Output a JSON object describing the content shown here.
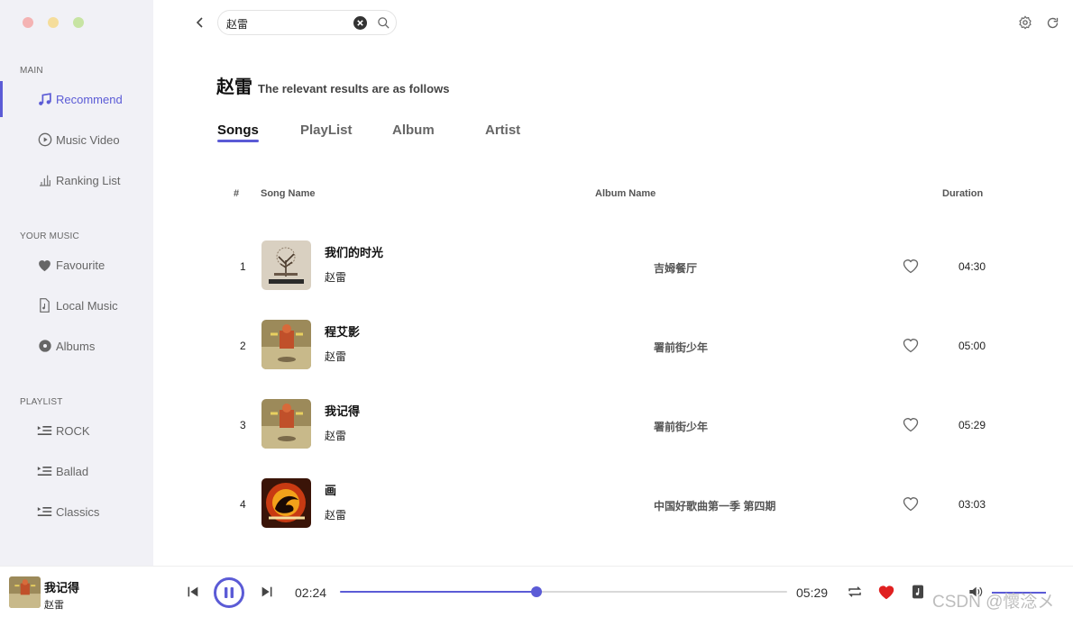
{
  "sidebar": {
    "sections": [
      {
        "label": "MAIN",
        "items": [
          {
            "label": "Recommend",
            "icon": "music-note-icon",
            "active": true
          },
          {
            "label": "Music Video",
            "icon": "play-circle-icon"
          },
          {
            "label": "Ranking List",
            "icon": "bar-chart-icon"
          }
        ]
      },
      {
        "label": "YOUR MUSIC",
        "items": [
          {
            "label": "Favourite",
            "icon": "heart-icon"
          },
          {
            "label": "Local Music",
            "icon": "file-music-icon"
          },
          {
            "label": "Albums",
            "icon": "disc-icon"
          }
        ]
      },
      {
        "label": "PLAYLIST",
        "items": [
          {
            "label": "ROCK",
            "icon": "playlist-icon"
          },
          {
            "label": "Ballad",
            "icon": "playlist-icon"
          },
          {
            "label": "Classics",
            "icon": "playlist-icon"
          }
        ]
      }
    ]
  },
  "search": {
    "value": "赵雷",
    "placeholder": ""
  },
  "result": {
    "query": "赵雷",
    "subtitle": "The relevant results are as follows"
  },
  "tabs": [
    {
      "label": "Songs",
      "active": true
    },
    {
      "label": "PlayList"
    },
    {
      "label": "Album"
    },
    {
      "label": "Artist"
    }
  ],
  "table": {
    "headers": {
      "index": "#",
      "song": "Song Name",
      "album": "Album Name",
      "duration": "Duration"
    },
    "rows": [
      {
        "index": "1",
        "name": "我们的时光",
        "artist": "赵雷",
        "album": "吉姆餐厅",
        "duration": "04:30",
        "cover": "restaurant"
      },
      {
        "index": "2",
        "name": "程艾影",
        "artist": "赵雷",
        "album": "署前街少年",
        "duration": "05:00",
        "cover": "street"
      },
      {
        "index": "3",
        "name": "我记得",
        "artist": "赵雷",
        "album": "署前街少年",
        "duration": "05:29",
        "cover": "street"
      },
      {
        "index": "4",
        "name": "画",
        "artist": "赵雷",
        "album": "中国好歌曲第一季 第四期",
        "duration": "03:03",
        "cover": "sing"
      }
    ]
  },
  "player": {
    "title": "我记得",
    "artist": "赵雷",
    "current_time": "02:24",
    "total_time": "05:29",
    "progress": 0.44,
    "liked": true
  },
  "watermark": "CSDN @懷淰メ",
  "colors": {
    "accent": "#5b5bd6",
    "like": "#e02020",
    "sidebar_bg": "#f1f1f6"
  }
}
